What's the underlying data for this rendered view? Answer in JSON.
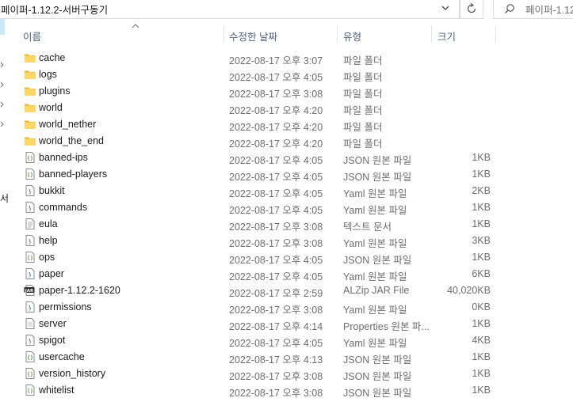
{
  "address_bar": {
    "path": "페이퍼-1.12.2-서버구동기"
  },
  "search": {
    "placeholder": "페이퍼-1.12"
  },
  "nav_pane": {
    "partial_label": "서"
  },
  "columns": {
    "name": "이름",
    "date": "수정한 날짜",
    "type": "유형",
    "size": "크기"
  },
  "files": [
    {
      "name": "cache",
      "date": "2022-08-17 오후 3:07",
      "type": "파일 폴더",
      "size": "",
      "icon": "folder-icon"
    },
    {
      "name": "logs",
      "date": "2022-08-17 오후 4:05",
      "type": "파일 폴더",
      "size": "",
      "icon": "folder-icon"
    },
    {
      "name": "plugins",
      "date": "2022-08-17 오후 3:08",
      "type": "파일 폴더",
      "size": "",
      "icon": "folder-icon"
    },
    {
      "name": "world",
      "date": "2022-08-17 오후 4:20",
      "type": "파일 폴더",
      "size": "",
      "icon": "folder-icon"
    },
    {
      "name": "world_nether",
      "date": "2022-08-17 오후 4:20",
      "type": "파일 폴더",
      "size": "",
      "icon": "folder-icon"
    },
    {
      "name": "world_the_end",
      "date": "2022-08-17 오후 4:20",
      "type": "파일 폴더",
      "size": "",
      "icon": "folder-icon"
    },
    {
      "name": "banned-ips",
      "date": "2022-08-17 오후 4:05",
      "type": "JSON 원본 파일",
      "size": "1KB",
      "icon": "json-file-icon"
    },
    {
      "name": "banned-players",
      "date": "2022-08-17 오후 4:05",
      "type": "JSON 원본 파일",
      "size": "1KB",
      "icon": "json-file-icon"
    },
    {
      "name": "bukkit",
      "date": "2022-08-17 오후 4:05",
      "type": "Yaml 원본 파일",
      "size": "2KB",
      "icon": "yaml-file-icon"
    },
    {
      "name": "commands",
      "date": "2022-08-17 오후 4:05",
      "type": "Yaml 원본 파일",
      "size": "1KB",
      "icon": "yaml-file-icon"
    },
    {
      "name": "eula",
      "date": "2022-08-17 오후 3:08",
      "type": "텍스트 문서",
      "size": "1KB",
      "icon": "text-file-icon"
    },
    {
      "name": "help",
      "date": "2022-08-17 오후 3:08",
      "type": "Yaml 원본 파일",
      "size": "3KB",
      "icon": "yaml-file-icon"
    },
    {
      "name": "ops",
      "date": "2022-08-17 오후 4:05",
      "type": "JSON 원본 파일",
      "size": "1KB",
      "icon": "json-file-icon"
    },
    {
      "name": "paper",
      "date": "2022-08-17 오후 4:05",
      "type": "Yaml 원본 파일",
      "size": "6KB",
      "icon": "yaml-file-icon"
    },
    {
      "name": "paper-1.12.2-1620",
      "date": "2022-08-17 오후 2:59",
      "type": "ALZip JAR File",
      "size": "40,020KB",
      "icon": "jar-file-icon"
    },
    {
      "name": "permissions",
      "date": "2022-08-17 오후 3:08",
      "type": "Yaml 원본 파일",
      "size": "0KB",
      "icon": "yaml-file-icon"
    },
    {
      "name": "server",
      "date": "2022-08-17 오후 4:14",
      "type": "Properties 원본 파...",
      "size": "1KB",
      "icon": "properties-file-icon"
    },
    {
      "name": "spigot",
      "date": "2022-08-17 오후 4:05",
      "type": "Yaml 원본 파일",
      "size": "4KB",
      "icon": "yaml-file-icon"
    },
    {
      "name": "usercache",
      "date": "2022-08-17 오후 4:13",
      "type": "JSON 원본 파일",
      "size": "1KB",
      "icon": "json-file-icon"
    },
    {
      "name": "version_history",
      "date": "2022-08-17 오후 3:08",
      "type": "JSON 원본 파일",
      "size": "1KB",
      "icon": "json-file-icon"
    },
    {
      "name": "whitelist",
      "date": "2022-08-17 오후 3:08",
      "type": "JSON 원본 파일",
      "size": "1KB",
      "icon": "json-file-icon"
    }
  ],
  "colors": {
    "folder": "#ffd766",
    "folder_dark": "#e8b43a",
    "header_text": "#4c607a",
    "secondary_text": "#6d6d6d",
    "selection": "#cce8ff"
  }
}
